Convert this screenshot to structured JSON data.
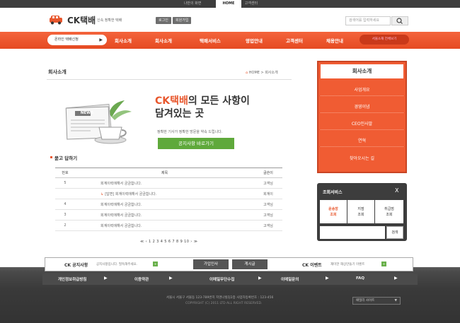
{
  "topbar": {
    "tabs": [
      "나만의 화면",
      "HOME",
      "고객센터"
    ]
  },
  "header": {
    "logo": "CK택배",
    "tagline": "신속 정확한 택배",
    "login": "로그인",
    "join": "회원가입",
    "search_placeholder": "검색어를 입력하세요"
  },
  "nav": {
    "track_button": "온라인 택배신청",
    "items": [
      "회사소개",
      "회사소개",
      "택배서비스",
      "영업안내",
      "고객센터",
      "채용안내"
    ],
    "right_button": "서울소재 전체보기"
  },
  "main": {
    "page_title": "회사소개",
    "breadcrumb_home": "HOME",
    "breadcrumb_current": "회사소개",
    "headline_accent": "CK택배",
    "headline_rest": "의 모든 사항이",
    "headline_line2": "담겨있는 곳",
    "newspaper_label": "NEWS",
    "hero_sub": "정확한 기사가 정확한 방문을 약속 드립니다.",
    "notice_button": "공지사항 바로가기"
  },
  "qa": {
    "title": "묻고 답하기",
    "headers": [
      "번호",
      "제목",
      "글쓴이"
    ],
    "rows": [
      {
        "no": "5",
        "title": "회계이력에해서 궁금합니다.",
        "author": "고객님",
        "reply": false
      },
      {
        "no": "",
        "title": "[답변] 회계이력에해서 궁금합니다.",
        "author": "회계이",
        "reply": true
      },
      {
        "no": "4",
        "title": "회계이력에해서 궁금합니다.",
        "author": "고객님",
        "reply": false
      },
      {
        "no": "3",
        "title": "회계이력에해서 궁금합니다.",
        "author": "고객님",
        "reply": false
      },
      {
        "no": "2",
        "title": "회계이력에해서 궁금합니다.",
        "author": "고객님",
        "reply": false
      }
    ],
    "pager": "≪ ‹ 1 2 3 4 5 6 7 8 9 10 › ≫"
  },
  "sidebar": {
    "title": "회사소개",
    "items": [
      "사업개요",
      "경영이념",
      "CEO인사말",
      "연혁",
      "찾아오시는 길"
    ]
  },
  "lookup": {
    "title": "조회서비스",
    "close": "X",
    "tabs": [
      {
        "line1": "운송장",
        "line2": "조회"
      },
      {
        "line1": "지점",
        "line2": "조회"
      },
      {
        "line1": "취급점",
        "line2": "조회"
      }
    ],
    "search_button": "검색"
  },
  "notice_bar": {
    "left_label": "CK 공지사항",
    "left_text": "공지사항입니다. 필독해주세요.",
    "btn1": "가입인사",
    "btn2": "게시글",
    "right_label": "CK 이벤트",
    "right_text": "재미한 해상만들기 이벤트"
  },
  "footer": {
    "links": [
      "개인정보취급방침",
      "이용약관",
      "이메일무단수집",
      "이메일문의",
      "FAQ"
    ],
    "address": "서울시 서울구 서울동 123-789번지 지엔나빌딩2층 사업자등록번호 : 123-456",
    "copyright": "COPYRIGHT (C) 2011 LTD ALL RIGHT RESERVED.",
    "family_site": "패밀리 사이트"
  },
  "colors": {
    "accent": "#e8572d",
    "nav": "#f05c33",
    "green": "#5fa93b",
    "footer": "#3a3a3a"
  }
}
